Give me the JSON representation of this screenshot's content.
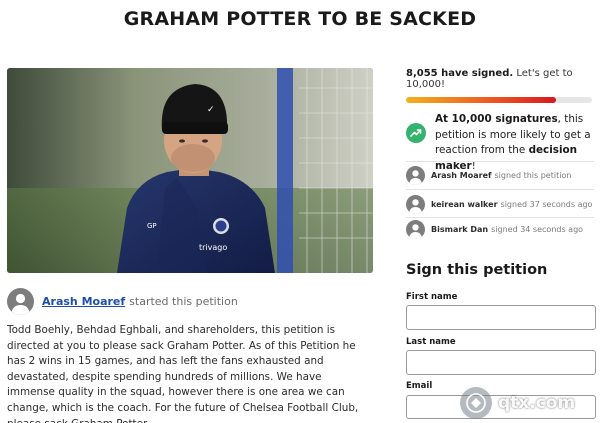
{
  "page": {
    "title": "GRAHAM POTTER TO BE SACKED"
  },
  "starter": {
    "name": "Arash Moaref",
    "action": "started this petition"
  },
  "description": "Todd Boehly, Behdad Eghbali, and shareholders, this petition is directed at you to please sack Graham Potter. As of this Petition he has 2 wins in 15 games, and has left the fans exhausted and devastated, despite spending hundreds of millions. We have immense quality in the squad, however there is one area we can change, which is the coach. For the future of Chelsea Football Club, please sack Graham Potter.",
  "progress": {
    "signed_count": "8,055 have signed.",
    "goal_text": "Let's get to 10,000!",
    "fraction": 0.8055
  },
  "goal_message": {
    "strong1": "At 10,000 signatures",
    "mid": ", this petition is more likely to get a reaction from the ",
    "strong2": "decision maker",
    "end": "!"
  },
  "recent_signers": [
    {
      "name": "Arash Moaref",
      "action": "signed this petition"
    },
    {
      "name": "keirean walker",
      "action": "signed 37 seconds ago"
    },
    {
      "name": "Bismark Dan",
      "action": "signed 34 seconds ago"
    }
  ],
  "form": {
    "heading": "Sign this petition",
    "first_name_label": "First name",
    "last_name_label": "Last name",
    "email_label": "Email"
  },
  "watermark": {
    "text": "qtx.com"
  },
  "colors": {
    "link": "#1d4fa6",
    "progress_start": "#f2b01e",
    "progress_end": "#d8171f",
    "goal_icon": "#33b36b",
    "avatar": "#7d7d7d"
  }
}
